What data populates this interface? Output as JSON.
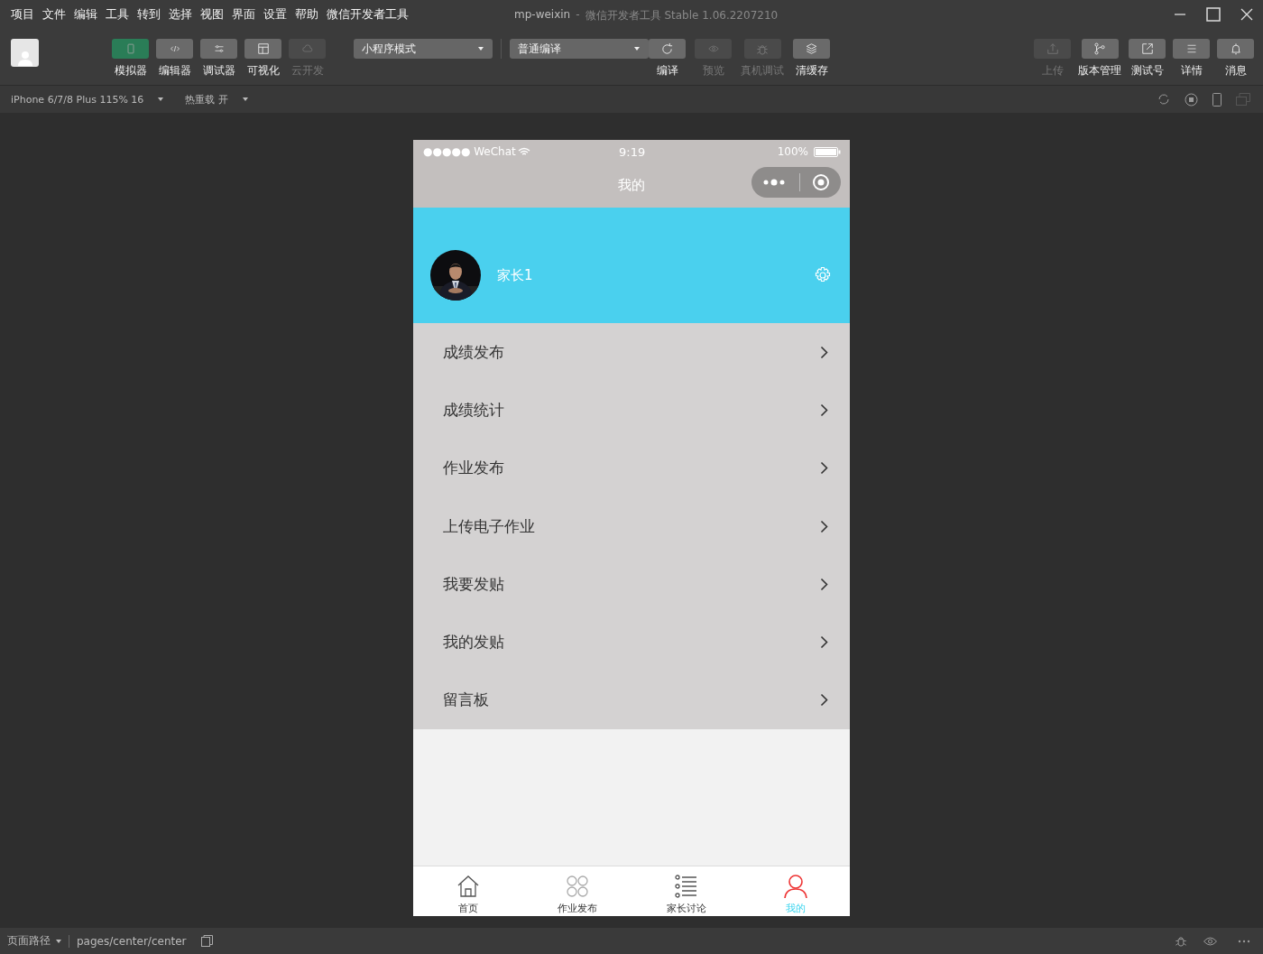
{
  "menu_bar": {
    "items": [
      "项目",
      "文件",
      "编辑",
      "工具",
      "转到",
      "选择",
      "视图",
      "界面",
      "设置",
      "帮助",
      "微信开发者工具"
    ]
  },
  "window": {
    "title": "mp-weixin",
    "separator": "-",
    "subtitle": "微信开发者工具 Stable 1.06.2207210"
  },
  "toolbar": {
    "view_buttons": [
      {
        "label": "模拟器",
        "selected": true,
        "disabled": false
      },
      {
        "label": "编辑器",
        "selected": false,
        "disabled": false
      },
      {
        "label": "调试器",
        "selected": false,
        "disabled": false
      },
      {
        "label": "可视化",
        "selected": false,
        "disabled": false
      },
      {
        "label": "云开发",
        "selected": false,
        "disabled": true
      }
    ],
    "mode_select": {
      "value": "小程序模式"
    },
    "compile_select": {
      "value": "普通编译"
    },
    "actions": [
      {
        "label": "编译",
        "disabled": false
      },
      {
        "label": "预览",
        "disabled": true
      },
      {
        "label": "真机调试",
        "disabled": true
      },
      {
        "label": "清缓存",
        "disabled": false
      }
    ],
    "right_actions": [
      {
        "label": "上传",
        "disabled": true
      },
      {
        "label": "版本管理",
        "disabled": false
      },
      {
        "label": "测试号",
        "disabled": false
      },
      {
        "label": "详情",
        "disabled": false
      },
      {
        "label": "消息",
        "disabled": false
      }
    ]
  },
  "sub_bar": {
    "device": "iPhone 6/7/8 Plus 115% 16",
    "hot_reload": "热重载 开"
  },
  "phone": {
    "status": {
      "carrier": "●●●●● WeChat",
      "time": "9:19",
      "battery": "100%"
    },
    "nav_title": "我的",
    "profile": {
      "name": "家长1"
    },
    "menu": [
      "成绩发布",
      "成绩统计",
      "作业发布",
      "上传电子作业",
      "我要发贴",
      "我的发贴",
      "留言板"
    ],
    "tabs": [
      {
        "label": "首页",
        "selected": false
      },
      {
        "label": "作业发布",
        "selected": false
      },
      {
        "label": "家长讨论",
        "selected": false
      },
      {
        "label": "我的",
        "selected": true
      }
    ]
  },
  "status_bar": {
    "label": "页面路径",
    "path": "pages/center/center"
  }
}
